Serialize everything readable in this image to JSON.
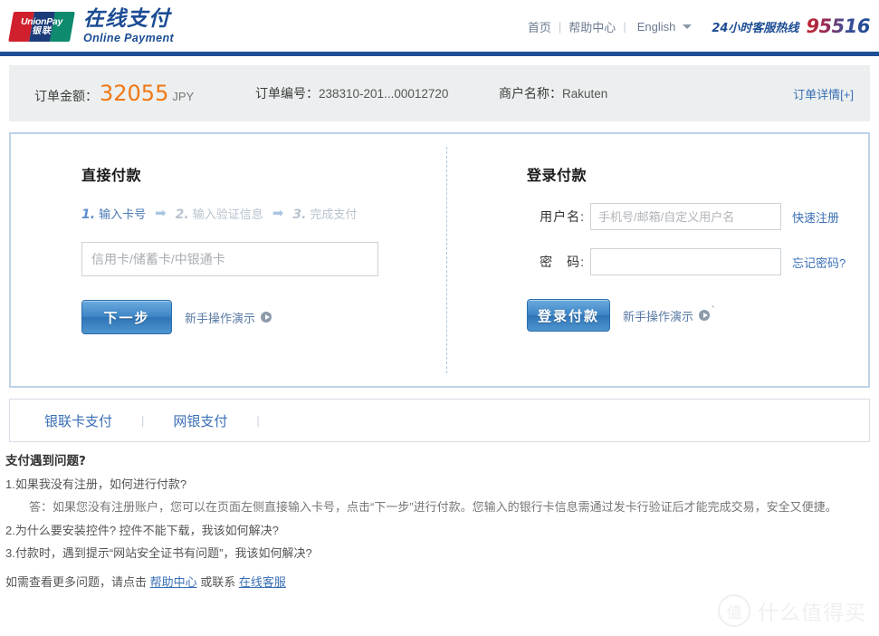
{
  "header": {
    "logo": {
      "mark_line1": "UnionPay",
      "mark_line2": "银联",
      "brand_cn": "在线支付",
      "brand_en": "Online Payment"
    },
    "nav": {
      "home": "首页",
      "sep1": "|",
      "help": "帮助中心",
      "sep2": "|",
      "language": "English",
      "hotline_label": "24小时客服热线",
      "hotline_number": "95516"
    }
  },
  "order": {
    "amount_label": "订单金额：",
    "amount_value": "32055",
    "currency": "JPY",
    "number_label": "订单编号：",
    "number_value": "238310-201...00012720",
    "merchant_label": "商户名称：",
    "merchant_value": "Rakuten",
    "detail_link": "订单详情[+]"
  },
  "direct_pay": {
    "title": "直接付款",
    "steps": [
      {
        "num": "1.",
        "label": "输入卡号"
      },
      {
        "num": "2.",
        "label": "输入验证信息"
      },
      {
        "num": "3.",
        "label": "完成支付"
      }
    ],
    "arrow": "➡",
    "card_placeholder": "信用卡/储蓄卡/中银通卡",
    "card_value": "",
    "next_button": "下一步",
    "demo_link": "新手操作演示"
  },
  "login_pay": {
    "title": "登录付款",
    "username_label": "用户名:",
    "username_placeholder": "手机号/邮箱/自定义用户名",
    "username_value": "",
    "register_link": "快速注册",
    "password_label": "密　码:",
    "password_value": "",
    "forgot_link": "忘记密码?",
    "login_button": "登录付款",
    "demo_link": "新手操作演示",
    "cursor_mark": "`"
  },
  "tabs": {
    "items": [
      "银联卡支付",
      "网银支付"
    ],
    "separator": "|"
  },
  "faq": {
    "title": "支付遇到问题?",
    "items": [
      {
        "q": "1.如果我没有注册，如何进行付款?",
        "a": "答：如果您没有注册账户，您可以在页面左侧直接输入卡号，点击“下一步”进行付款。您输入的银行卡信息需通过发卡行验证后才能完成交易，安全又便捷。"
      },
      {
        "q": "2.为什么要安装控件? 控件不能下载，我该如何解决?",
        "a": ""
      },
      {
        "q": "3.付款时，遇到提示“网站安全证书有问题”，我该如何解决?",
        "a": ""
      }
    ],
    "footer_prefix": "如需查看更多问题，请点击 ",
    "footer_link1": "帮助中心",
    "footer_middle": " 或联系 ",
    "footer_link2": "在线客服"
  },
  "watermark": {
    "mark": "值",
    "text": "什么值得买"
  },
  "colors": {
    "brand_blue": "#1b4c93",
    "rule_blue": "#1f4e96",
    "amount_orange": "#f07814",
    "link_blue": "#3a6fb5",
    "panel_border": "#bed2e8",
    "order_bg": "#ecefef"
  }
}
